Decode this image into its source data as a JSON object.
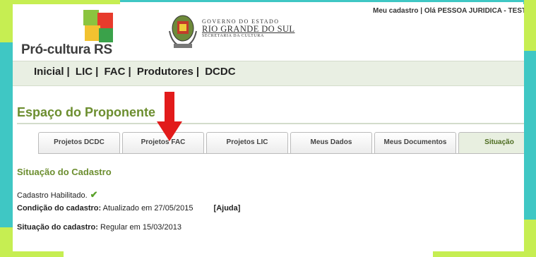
{
  "brand": {
    "logo_text": "Pró-cultura RS"
  },
  "gov": {
    "line1": "GOVERNO DO ESTADO",
    "line2": "RIO GRANDE DO SUL",
    "line3": "SECRETARIA DA CULTURA"
  },
  "topbar": {
    "text": "Meu cadastro | Olá PESSOA JURIDICA - TESTE | (S"
  },
  "nav": {
    "items": [
      "Inicial",
      "LIC",
      "FAC",
      "Produtores",
      "DCDC"
    ]
  },
  "page_title": "Espaço do Proponente",
  "tabs": [
    "Projetos DCDC",
    "Projetos FAC",
    "Projetos LIC",
    "Meus Dados",
    "Meus Documentos",
    "Situação"
  ],
  "active_tab": "Situação",
  "section_title": "Situação do Cadastro",
  "status": {
    "enabled_text": "Cadastro Habilitado.",
    "condition_label": "Condição do cadastro:",
    "condition_value": "Atualizado em 27/05/2015",
    "help_link": "[Ajuda]",
    "situation_label": "Situação do cadastro:",
    "situation_value": "Regular em 15/03/2013"
  },
  "colors": {
    "accent_green": "#6c8e2f",
    "frame_teal": "#3fc7c4",
    "frame_lime": "#c6ee52",
    "arrow_red": "#e21b1b"
  }
}
